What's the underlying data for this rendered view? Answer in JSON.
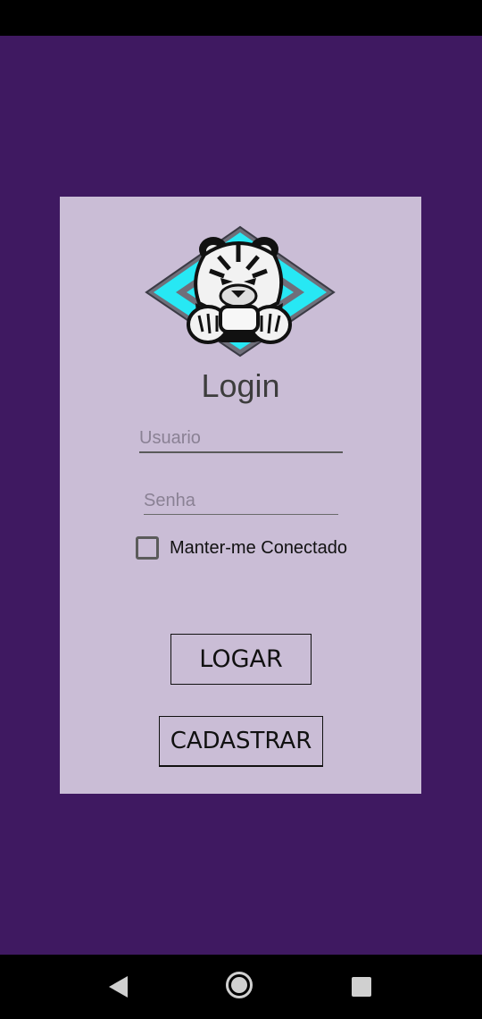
{
  "colors": {
    "background": "#3f1961",
    "card": "#cabdd6",
    "logo_accent": "#27e8f4"
  },
  "logo": {
    "name": "tiger-gamer-logo"
  },
  "login": {
    "title": "Login",
    "username_placeholder": "Usuario",
    "password_placeholder": "Senha",
    "remember_label": "Manter-me Conectado",
    "remember_checked": false,
    "login_button": "LOGAR",
    "register_button": "CADASTRAR"
  },
  "navigation": {
    "back_icon": "back-triangle-icon",
    "home_icon": "home-circle-icon",
    "recents_icon": "recents-square-icon"
  }
}
